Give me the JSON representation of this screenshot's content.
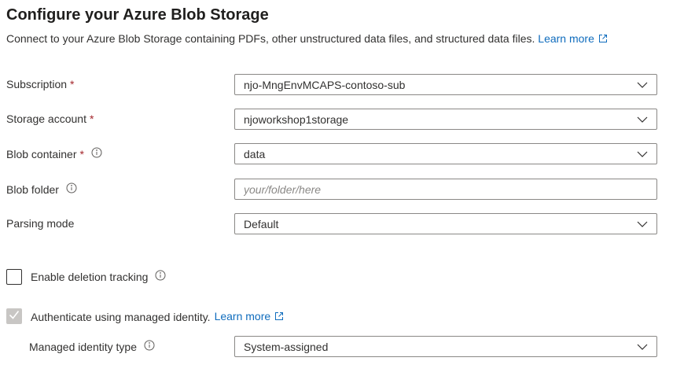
{
  "header": {
    "title": "Configure your Azure Blob Storage",
    "description": "Connect to your Azure Blob Storage containing PDFs, other unstructured data files, and structured data files.",
    "learn_more": "Learn more"
  },
  "form": {
    "subscription": {
      "label": "Subscription",
      "required": "*",
      "value": "njo-MngEnvMCAPS-contoso-sub"
    },
    "storage_account": {
      "label": "Storage account",
      "required": "*",
      "value": "njoworkshop1storage"
    },
    "blob_container": {
      "label": "Blob container",
      "required": "*",
      "value": "data"
    },
    "blob_folder": {
      "label": "Blob folder",
      "placeholder": "your/folder/here",
      "value": ""
    },
    "parsing_mode": {
      "label": "Parsing mode",
      "value": "Default"
    }
  },
  "deletion_tracking": {
    "label": "Enable deletion tracking",
    "checked": false
  },
  "managed_identity": {
    "label": "Authenticate using managed identity.",
    "learn_more": "Learn more",
    "checked": true,
    "type_label": "Managed identity type",
    "type_value": "System-assigned"
  },
  "colors": {
    "link": "#0f6cbd",
    "required": "#a4262c",
    "border": "#8a8886",
    "disabled_check": "#c8c6c4"
  },
  "icons": {
    "dropdown": "chevron-down-icon",
    "info": "info-icon",
    "external_link": "external-link-icon",
    "checkmark": "checkmark-icon"
  }
}
